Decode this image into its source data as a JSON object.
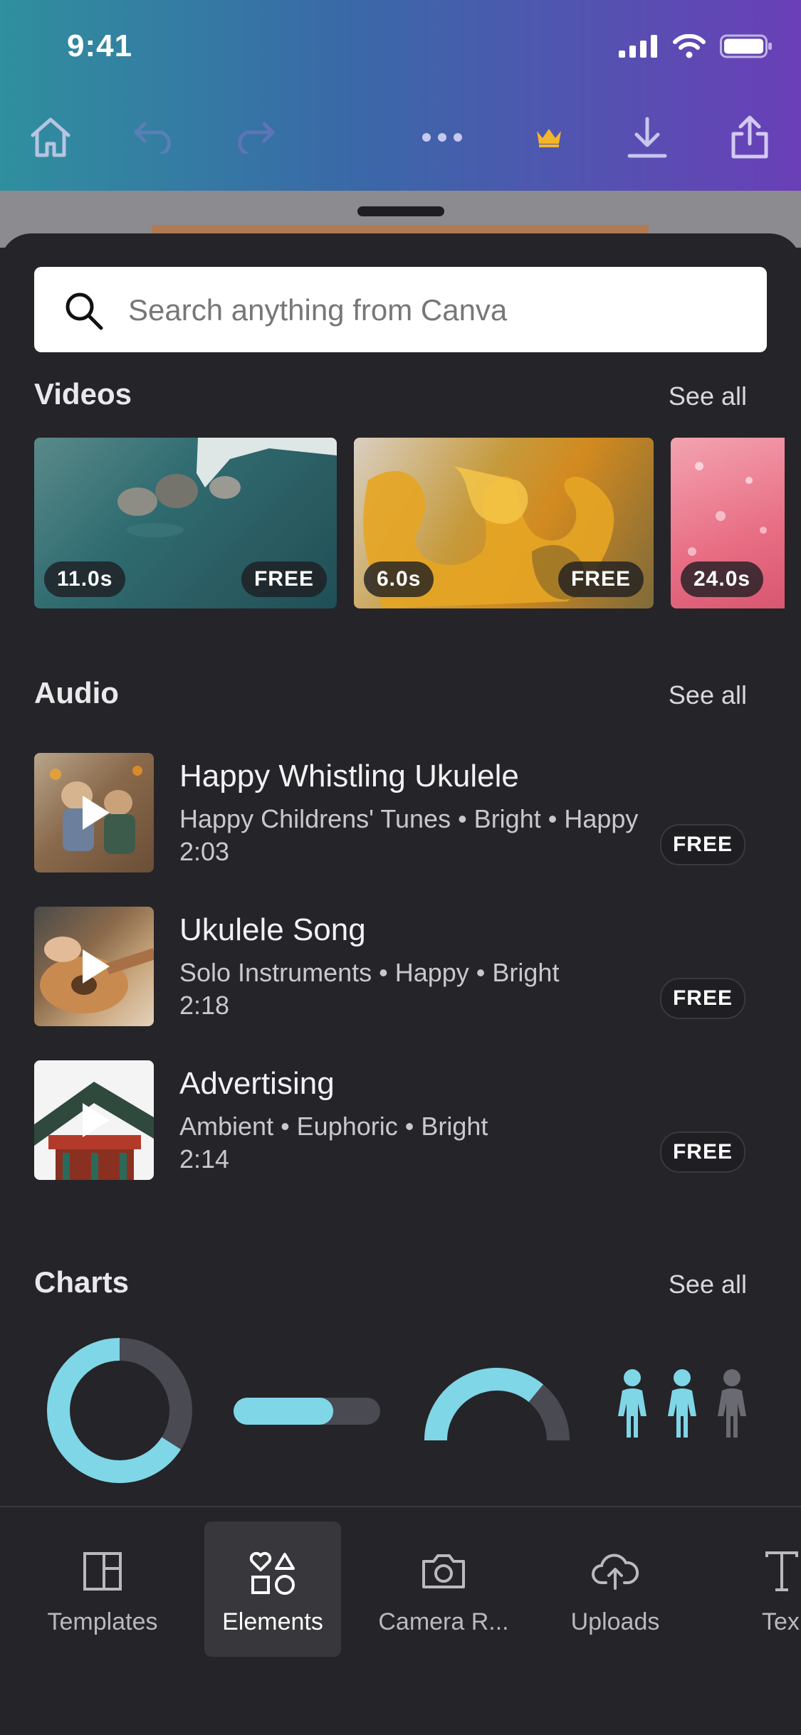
{
  "status_bar": {
    "time": "9:41"
  },
  "toolbar": {
    "home_icon": "home-icon",
    "undo_icon": "undo-icon",
    "redo_icon": "redo-icon",
    "more_icon": "more-icon",
    "crown_icon": "crown-icon",
    "download_icon": "download-icon",
    "share_icon": "share-icon"
  },
  "search": {
    "placeholder": "Search anything from Canva"
  },
  "videos": {
    "title": "Videos",
    "see_all": "See all",
    "items": [
      {
        "duration": "11.0s",
        "badge": "FREE"
      },
      {
        "duration": "6.0s",
        "badge": "FREE"
      },
      {
        "duration": "24.0s",
        "badge": ""
      }
    ]
  },
  "audio": {
    "title": "Audio",
    "see_all": "See all",
    "items": [
      {
        "title": "Happy Whistling Ukulele",
        "tags": "Happy Childrens' Tunes • Bright • Happy",
        "duration": "2:03",
        "badge": "FREE"
      },
      {
        "title": "Ukulele Song",
        "tags": "Solo Instruments • Happy • Bright",
        "duration": "2:18",
        "badge": "FREE"
      },
      {
        "title": "Advertising",
        "tags": "Ambient • Euphoric • Bright",
        "duration": "2:14",
        "badge": "FREE"
      }
    ]
  },
  "charts": {
    "title": "Charts",
    "see_all": "See all",
    "items": [
      {
        "type": "donut",
        "fill": 0.66
      },
      {
        "type": "progress-bar",
        "fill": 0.68
      },
      {
        "type": "half-gauge",
        "fill": 0.72
      },
      {
        "type": "people-icons",
        "filled": 2,
        "total": 3
      }
    ],
    "accent": "#7fd6e6",
    "track": "#4a4a52"
  },
  "bottom_nav": {
    "items": [
      {
        "label": "Templates",
        "icon": "templates-icon"
      },
      {
        "label": "Elements",
        "icon": "elements-icon",
        "active": true
      },
      {
        "label": "Camera R...",
        "icon": "camera-icon"
      },
      {
        "label": "Uploads",
        "icon": "upload-cloud-icon"
      },
      {
        "label": "Tex",
        "icon": "text-icon"
      }
    ]
  }
}
